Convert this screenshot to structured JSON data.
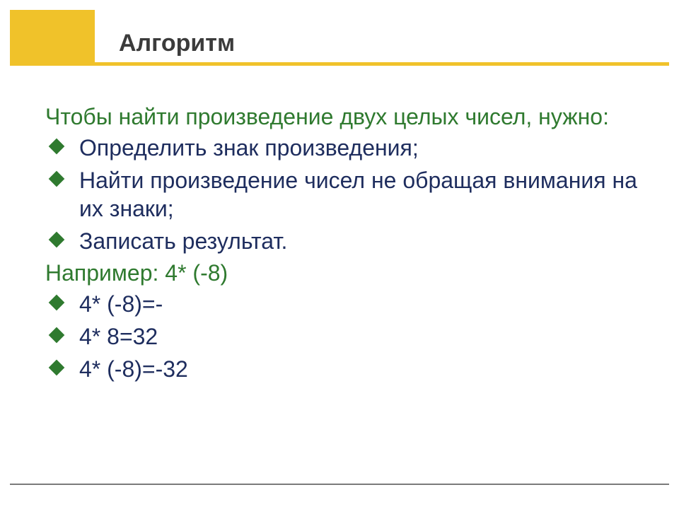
{
  "header": {
    "title": "Алгоритм"
  },
  "intro": "Чтобы найти произведение двух целых чисел, нужно:",
  "steps": [
    "Определить знак произведения;",
    "Найти произведение чисел не обращая внимания на их знаки;",
    "Записать результат."
  ],
  "example_label": "Например: 4* (-8)",
  "example_lines": [
    "4* (-8)=-",
    "4* 8=32",
    "4* (-8)=-32"
  ]
}
